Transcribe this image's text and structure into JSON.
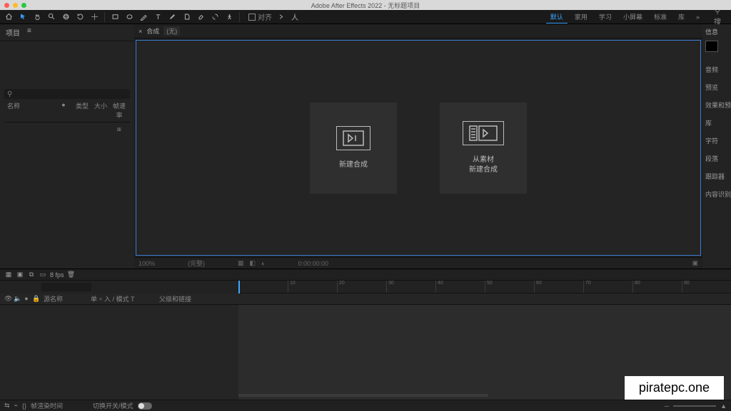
{
  "window": {
    "title": "Adobe After Effects 2022 - 无标题项目"
  },
  "toolbar": {
    "snap_label": "对齐",
    "search_placeholder": "搜"
  },
  "workspaces": {
    "items": [
      "默认",
      "家用",
      "学习",
      "小屏幕",
      "标准",
      "库"
    ],
    "active_index": 0
  },
  "project_panel": {
    "tab_label": "项目",
    "menu_glyph": "≡",
    "search_icon": "⚲",
    "columns": {
      "name": "名称",
      "tag": "●",
      "type": "类型",
      "size": "大小",
      "frame_rate": "帧速率"
    }
  },
  "composition_panel": {
    "prefix": "×",
    "label": "合成",
    "state": "(无)"
  },
  "start": {
    "new_comp": {
      "label": "新建合成"
    },
    "from_footage": {
      "line1": "从素材",
      "line2": "新建合成"
    }
  },
  "viewer_footer": {
    "zoom": "100%",
    "res": "(完整)",
    "time": "0:00:00:00"
  },
  "right_panel": {
    "title": "信息",
    "groups": [
      "音频",
      "预览",
      "效果和预设",
      "库",
      "字符",
      "段落",
      "跟踪器",
      "内容识别填充"
    ]
  },
  "bottom_strip": {
    "fps_label": "8 fps"
  },
  "timeline": {
    "header": {
      "source_name": "源名称",
      "mode_group": "单 ÷ 入 / 模式 T",
      "parent": "父级和链接"
    },
    "ticks": [
      "10",
      "20",
      "30",
      "40",
      "50",
      "60",
      "70",
      "80",
      "90"
    ],
    "footer": {
      "option1": "帧渲染时间",
      "option2": "切换开关/模式"
    }
  },
  "watermark": "piratepc.one"
}
